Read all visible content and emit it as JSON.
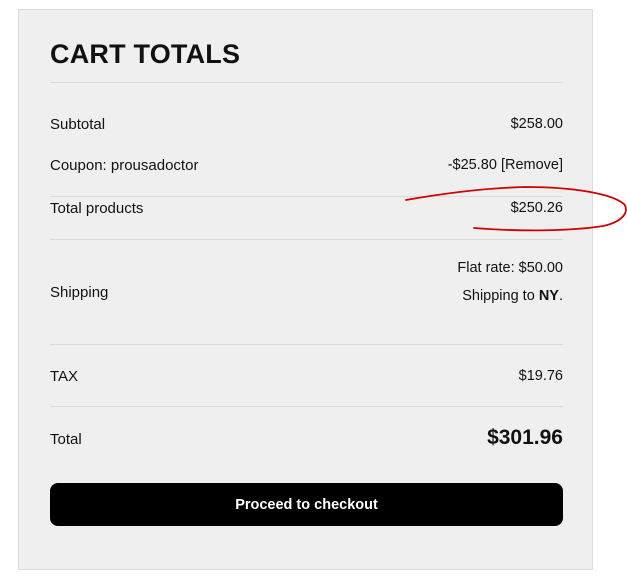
{
  "cart": {
    "title": "CART TOTALS",
    "subtotal": {
      "label": "Subtotal",
      "value": "$258.00"
    },
    "coupon": {
      "label": "Coupon: prousadoctor",
      "amount": "-$25.80",
      "remove_label": "[Remove]"
    },
    "total_products": {
      "label": "Total products",
      "value": "$250.26"
    },
    "shipping": {
      "label": "Shipping",
      "rate": "Flat rate: $50.00",
      "destination_prefix": "Shipping to ",
      "destination": "NY",
      "destination_suffix": "."
    },
    "tax": {
      "label": "TAX",
      "value": "$19.76"
    },
    "total": {
      "label": "Total",
      "value": "$301.96"
    },
    "checkout_label": "Proceed to checkout"
  },
  "colors": {
    "panel_background": "#efefef",
    "button_background": "#000000",
    "annotation": "#d00000"
  }
}
